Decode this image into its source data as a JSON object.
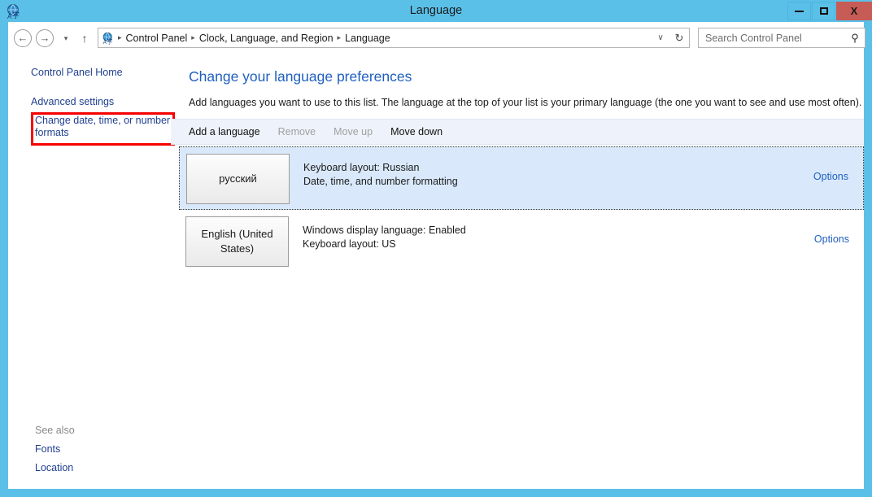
{
  "window": {
    "title": "Language",
    "app_icon": "language-globe-icon",
    "controls": {
      "minimize": "minimize-icon",
      "maximize": "maximize-icon",
      "close": "X"
    }
  },
  "nav": {
    "back_icon": "←",
    "forward_icon": "→",
    "recent_icon": "▾",
    "up_icon": "↑",
    "breadcrumbs": [
      "Control Panel",
      "Clock, Language, and Region",
      "Language"
    ],
    "separator": "▸",
    "chevron_icon": "∨",
    "refresh_icon": "↻",
    "search": {
      "placeholder": "Search Control Panel",
      "value": "",
      "icon": "⚲"
    }
  },
  "sidebar": {
    "links": [
      {
        "label": "Control Panel Home"
      },
      {
        "label": "Advanced settings"
      },
      {
        "label": "Change date, time, or number formats",
        "highlighted": true
      }
    ],
    "see_also": {
      "heading": "See also",
      "items": [
        {
          "label": "Fonts"
        },
        {
          "label": "Location"
        }
      ]
    },
    "highlight_color": "#f60000"
  },
  "main": {
    "title": "Change your language preferences",
    "description": "Add languages you want to use to this list. The language at the top of your list is your primary language (the one you want to see and use most often).",
    "toolbar": [
      {
        "label": "Add a language",
        "enabled": true
      },
      {
        "label": "Remove",
        "enabled": false
      },
      {
        "label": "Move up",
        "enabled": false
      },
      {
        "label": "Move down",
        "enabled": true
      }
    ],
    "languages": [
      {
        "name": "русский",
        "details": [
          "Keyboard layout: Russian",
          "Date, time, and number formatting"
        ],
        "options_label": "Options",
        "selected": true
      },
      {
        "name": "English (United States)",
        "details": [
          "Windows display language: Enabled",
          "Keyboard layout: US"
        ],
        "options_label": "Options",
        "selected": false
      }
    ]
  }
}
